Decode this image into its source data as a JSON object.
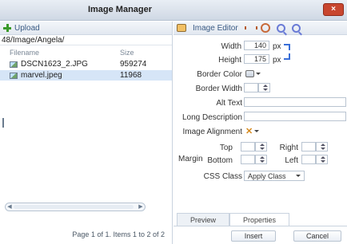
{
  "window": {
    "title": "Image Manager",
    "close_icon": "close-icon"
  },
  "left_panel": {
    "upload_label": "Upload",
    "path": "48/Image/Angela/",
    "columns": {
      "filename": "Filename",
      "size": "Size"
    },
    "files": [
      {
        "name": "DSCN1623_2.JPG",
        "size": "959274",
        "selected": false
      },
      {
        "name": "marvel.jpeg",
        "size": "11968",
        "selected": true
      }
    ],
    "pager": "Page 1 of 1. Items 1 to 2 of 2"
  },
  "right_panel": {
    "toolbar_label": "Image Editor",
    "width_label": "Width",
    "width_value": "140",
    "height_label": "Height",
    "height_value": "175",
    "unit": "px",
    "border_color_label": "Border Color",
    "border_width_label": "Border Width",
    "alt_text_label": "Alt Text",
    "long_desc_label": "Long Description",
    "image_alignment_label": "Image Alignment",
    "margin_label": "Margin",
    "margin_top": "Top",
    "margin_right": "Right",
    "margin_bottom": "Bottom",
    "margin_left": "Left",
    "css_class_label": "CSS Class",
    "css_class_value": "Apply Class",
    "tabs": [
      "Preview",
      "Properties"
    ],
    "active_tab": "Properties",
    "insert_label": "Insert",
    "cancel_label": "Cancel"
  }
}
